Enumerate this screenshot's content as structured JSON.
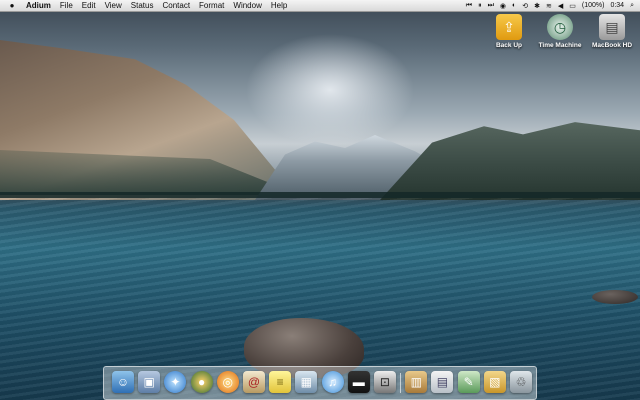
{
  "menubar": {
    "app_name": "Adium",
    "items": [
      "File",
      "Edit",
      "View",
      "Status",
      "Contact",
      "Format",
      "Window",
      "Help"
    ],
    "battery": "(100%)",
    "clock": "0:34"
  },
  "desktop_icons": [
    {
      "label": "Back Up",
      "icon": "backup-drive-icon"
    },
    {
      "label": "Time Machine",
      "icon": "time-machine-icon"
    },
    {
      "label": "MacBook HD",
      "icon": "hard-drive-icon"
    }
  ],
  "dock": {
    "items": [
      "finder",
      "preview",
      "safari",
      "adium",
      "itunes-cd",
      "address-book",
      "stickies",
      "iphoto",
      "itunes",
      "monitor",
      "screenshot",
      "downloads",
      "documents",
      "applications",
      "stacks",
      "trash"
    ]
  }
}
